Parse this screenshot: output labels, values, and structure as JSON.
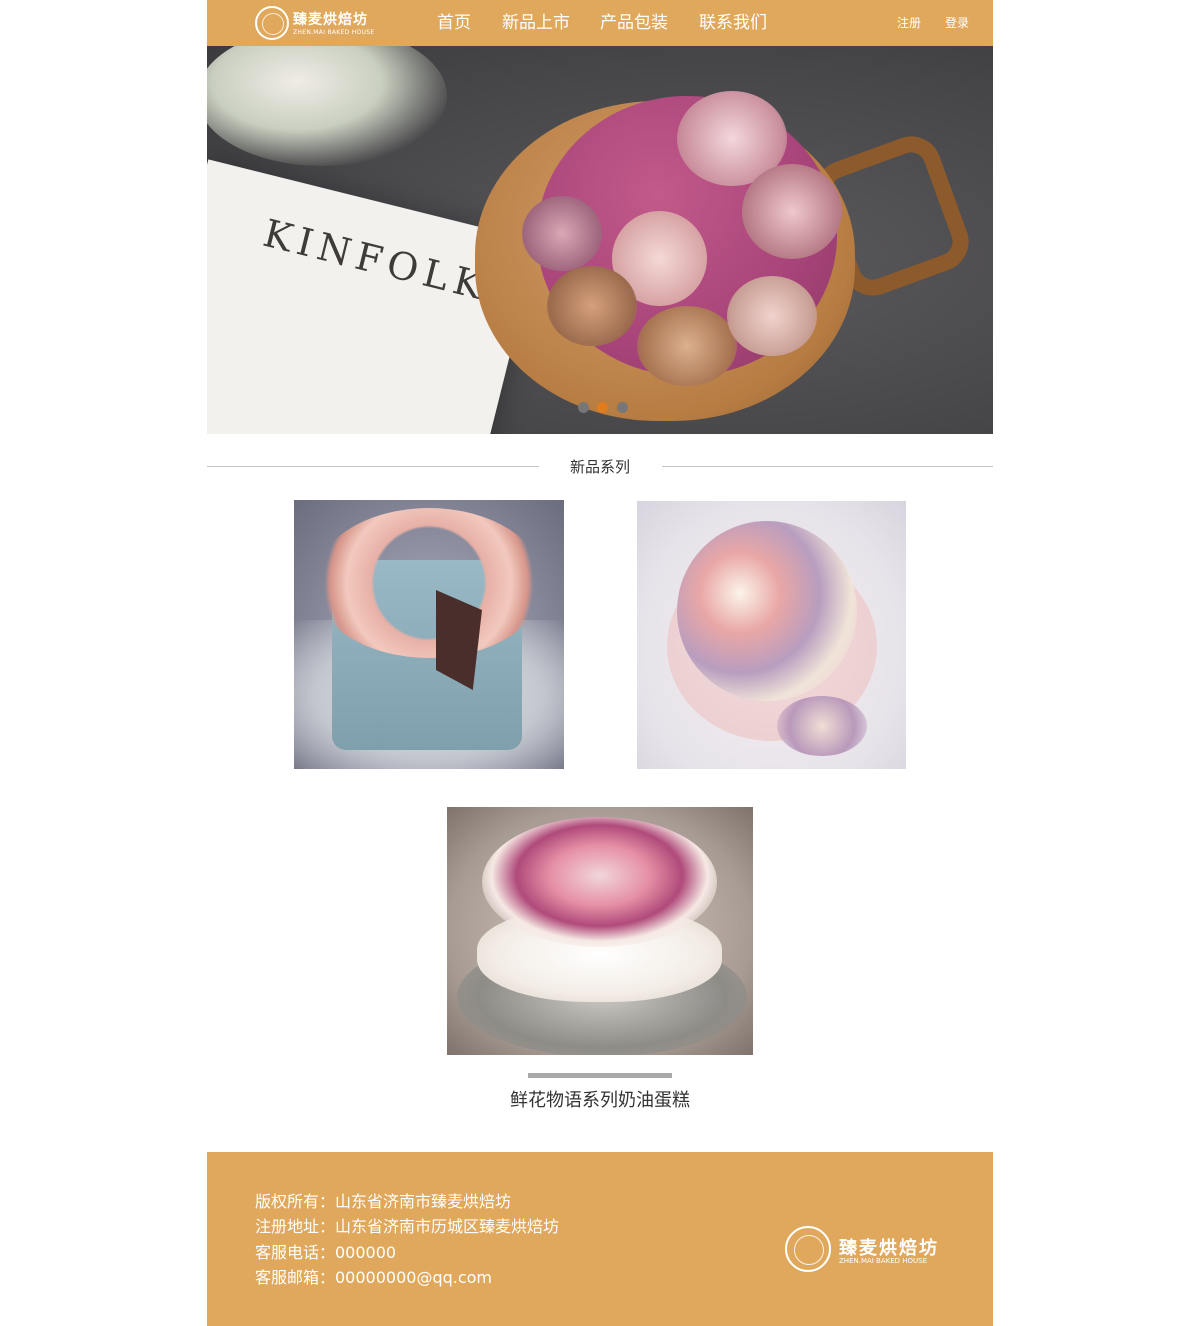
{
  "header": {
    "logo": {
      "name": "臻麦烘焙坊",
      "subtitle": "ZHEN.MAI BAKED HOUSE"
    },
    "nav": [
      "首页",
      "新品上市",
      "产品包装",
      "联系我们"
    ],
    "register": "注册",
    "login": "登录"
  },
  "banner": {
    "book_text": "KINFOLK",
    "slides_total": 3,
    "active_slide": 2
  },
  "section": {
    "title": "新品系列"
  },
  "products": {
    "items": [
      {
        "alt": "blue-cake-pink-roses"
      },
      {
        "alt": "pink-cake-pastel-roses"
      },
      {
        "alt": "cream-cake-edible-flowers"
      }
    ],
    "caption": "鲜花物语系列奶油蛋糕"
  },
  "footer": {
    "lines": [
      "版权所有：山东省济南市臻麦烘焙坊",
      "注册地址：山东省济南市历城区臻麦烘焙坊",
      "客服电话：000000",
      "客服邮箱：00000000@qq.com"
    ],
    "logo": {
      "name": "臻麦烘焙坊",
      "subtitle": "ZHEN.MAI BAKED HOUSE"
    }
  },
  "colors": {
    "brand": "#e0a85c",
    "active_dot": "#e07b1e"
  }
}
